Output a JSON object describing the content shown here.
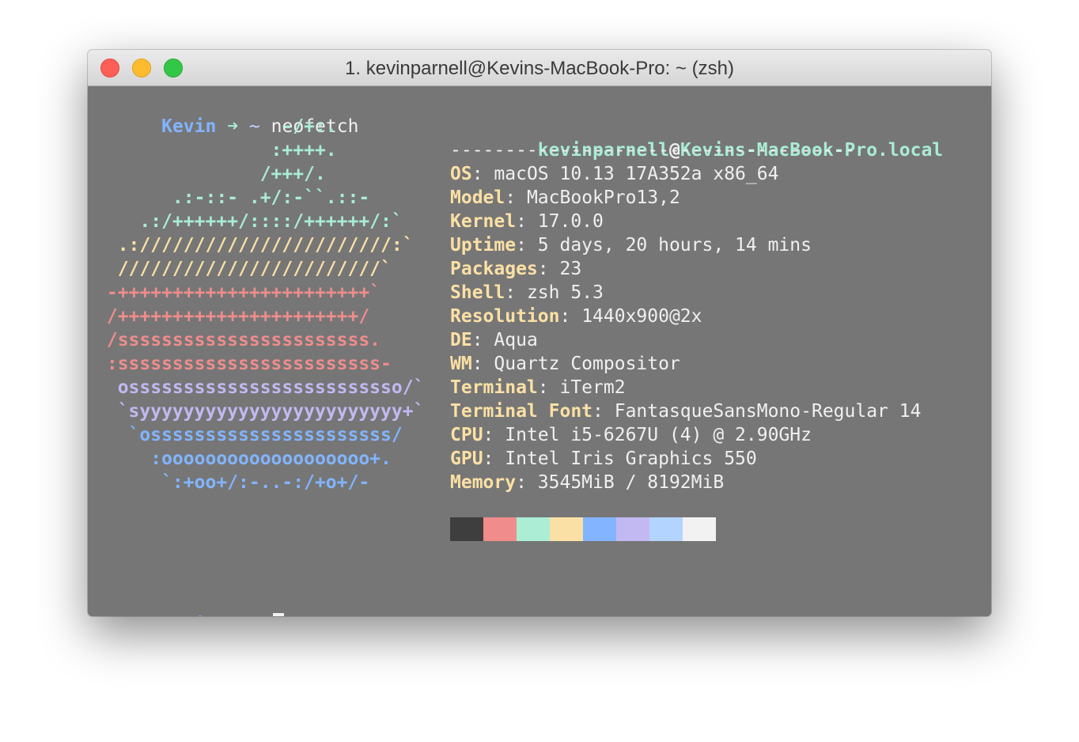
{
  "window": {
    "title": "1. kevinparnell@Kevins-MacBook-Pro: ~ (zsh)"
  },
  "prompt": {
    "user": "Kevin",
    "arrow": "➜",
    "dir": "~",
    "command": "neofetch"
  },
  "ascii_art": [
    {
      "text": "                 -/+:.",
      "color": "#a9ecd4"
    },
    {
      "text": "                :++++.",
      "color": "#a9ecd4"
    },
    {
      "text": "               /+++/.",
      "color": "#a9ecd4"
    },
    {
      "text": "       .:-::- .+/:-``.::-",
      "color": "#a9ecd4"
    },
    {
      "text": "    .:/++++++/::::/++++++/:`",
      "color": "#a9ecd4"
    },
    {
      "text": "  .:///////////////////////:`",
      "color": "#fbe0a5"
    },
    {
      "text": "  ////////////////////////`",
      "color": "#fbe0a5"
    },
    {
      "text": " -+++++++++++++++++++++++`",
      "color": "#f08c8c"
    },
    {
      "text": " /++++++++++++++++++++++/",
      "color": "#f08c8c"
    },
    {
      "text": " /sssssssssssssssssssssss.",
      "color": "#f08c8c"
    },
    {
      "text": " :ssssssssssssssssssssssss-",
      "color": "#f08c8c"
    },
    {
      "text": "  osssssssssssssssssssssssso/`",
      "color": "#c2b8f2"
    },
    {
      "text": "  `syyyyyyyyyyyyyyyyyyyyyyyy+`",
      "color": "#c2b8f2"
    },
    {
      "text": "   `ossssssssssssssssssssss/",
      "color": "#82b4ff"
    },
    {
      "text": "     :ooooooooooooooooooo+.",
      "color": "#82b4ff"
    },
    {
      "text": "      `:+oo+/:-..-:/+o+/-",
      "color": "#82b4ff"
    }
  ],
  "info": {
    "user_host": {
      "user": "kevinparnell",
      "at": "@",
      "host": "Kevins-MacBook-Pro.local"
    },
    "separator": "-------------------------------------",
    "fields": [
      {
        "key": "OS",
        "value": "macOS 10.13 17A352a x86_64"
      },
      {
        "key": "Model",
        "value": "MacBookPro13,2"
      },
      {
        "key": "Kernel",
        "value": "17.0.0"
      },
      {
        "key": "Uptime",
        "value": "5 days, 20 hours, 14 mins"
      },
      {
        "key": "Packages",
        "value": "23"
      },
      {
        "key": "Shell",
        "value": "zsh 5.3"
      },
      {
        "key": "Resolution",
        "value": "1440x900@2x"
      },
      {
        "key": "DE",
        "value": "Aqua"
      },
      {
        "key": "WM",
        "value": "Quartz Compositor"
      },
      {
        "key": "Terminal",
        "value": "iTerm2"
      },
      {
        "key": "Terminal Font",
        "value": "FantasqueSansMono-Regular 14"
      },
      {
        "key": "CPU",
        "value": "Intel i5-6267U (4) @ 2.90GHz"
      },
      {
        "key": "GPU",
        "value": "Intel Iris Graphics 550"
      },
      {
        "key": "Memory",
        "value": "3545MiB / 8192MiB"
      }
    ]
  },
  "palette": [
    "#3e3e3e",
    "#f08c8c",
    "#abeed5",
    "#fbe0a5",
    "#82b4ff",
    "#c2b8f2",
    "#b3d4ff",
    "#f2f2f2"
  ]
}
